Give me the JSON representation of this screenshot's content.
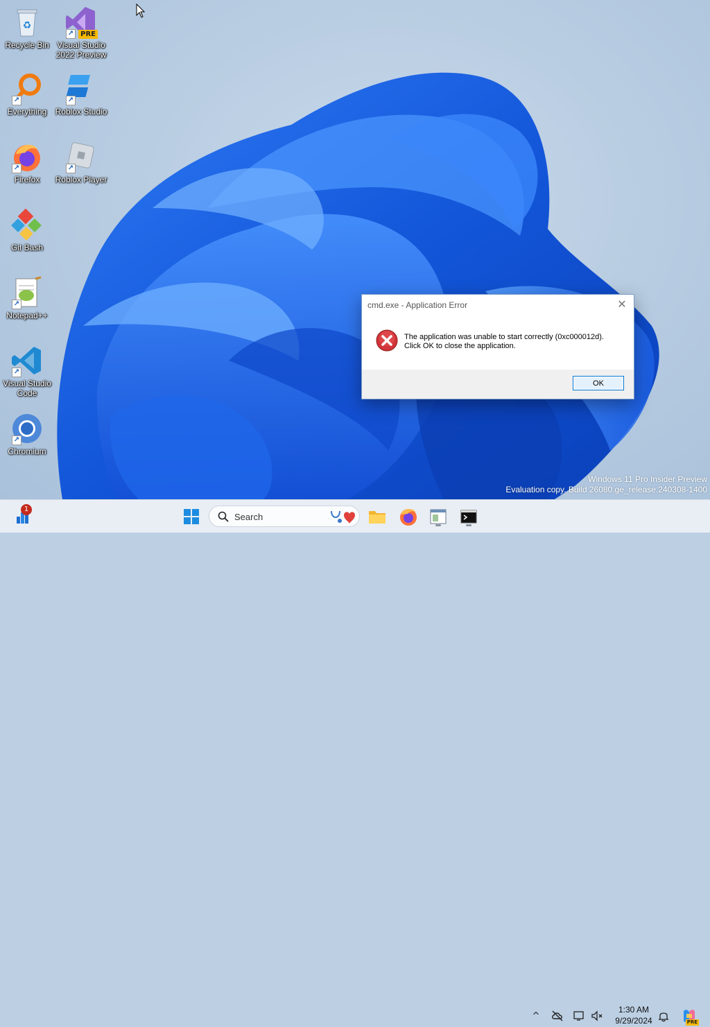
{
  "desktop": {
    "icons": [
      {
        "label": "Recycle Bin"
      },
      {
        "label": "Visual Studio 2022 Preview",
        "badge": "PRE"
      },
      {
        "label": "Everything"
      },
      {
        "label": "Roblox Studio"
      },
      {
        "label": "Firefox"
      },
      {
        "label": "Roblox Player"
      },
      {
        "label": "Git Bash"
      },
      {
        "label": "Notepad++"
      },
      {
        "label": "Visual Studio Code"
      },
      {
        "label": "Chromium"
      }
    ],
    "watermark": {
      "line1": "Windows 11 Pro Insider Preview",
      "line2": "Evaluation copy. Build 26080.ge_release.240308-1400"
    }
  },
  "dialog": {
    "title": "cmd.exe - Application Error",
    "close_glyph": "✕",
    "message_line1": "The application was unable to start correctly (0xc000012d).",
    "message_line2": "Click OK to close the application.",
    "ok_label": "OK",
    "icon": "error-icon"
  },
  "taskbar": {
    "widgets_badge": "1",
    "search_placeholder": "Search",
    "time": "1:30 AM",
    "date": "9/29/2024",
    "tray_chevron": "^",
    "copilot_badge": "PRE"
  },
  "colors": {
    "accent": "#0078d4",
    "error_red": "#c42b1c",
    "wallpaper_blue": "#1a5fe0"
  }
}
